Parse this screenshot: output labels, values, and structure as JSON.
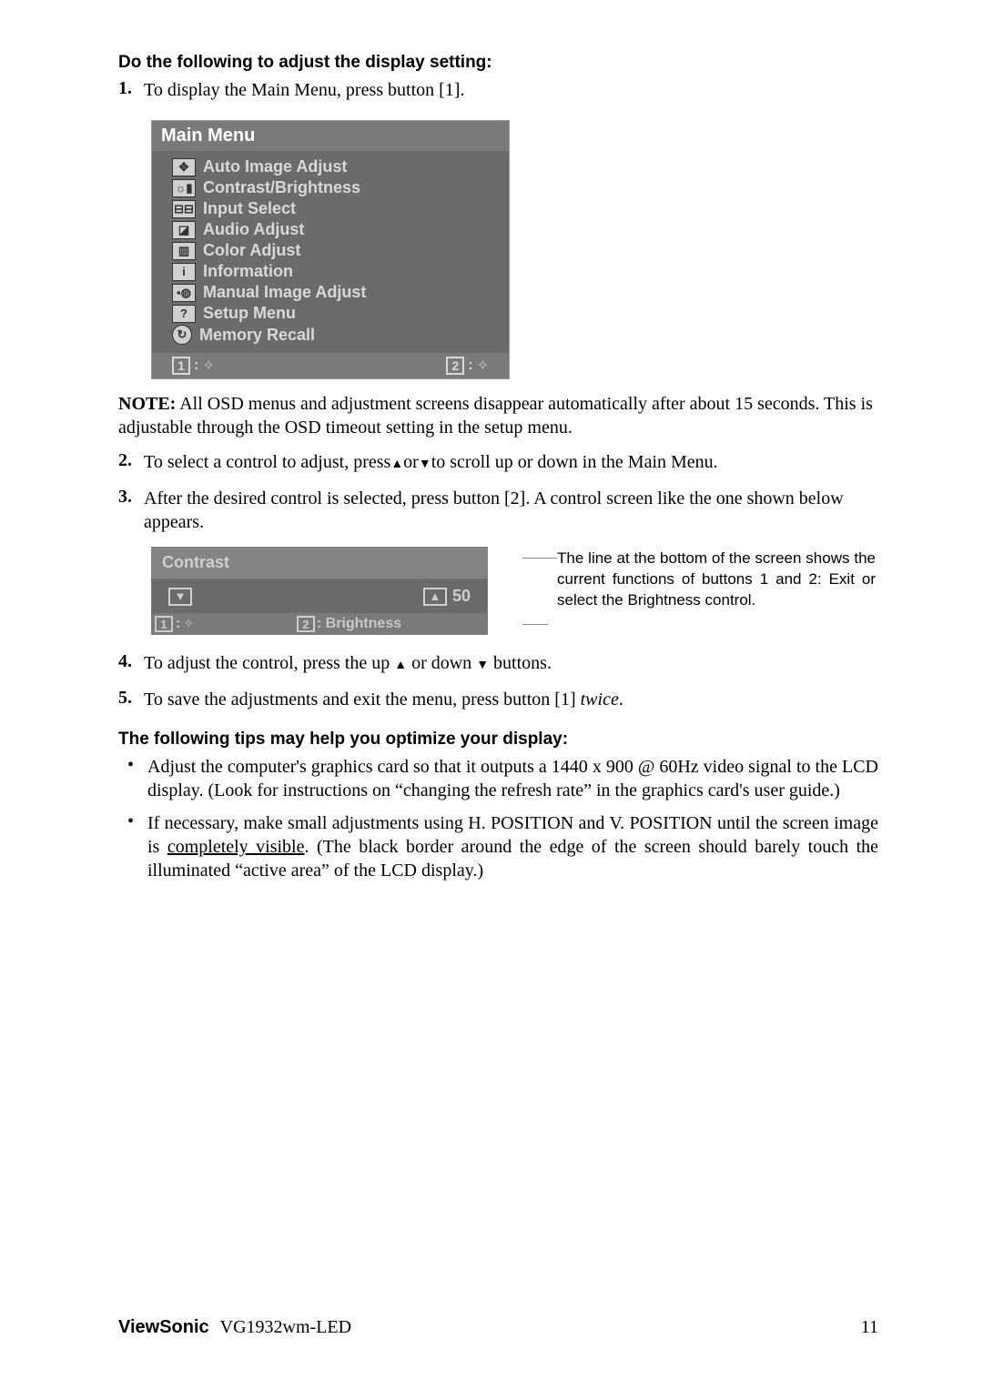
{
  "heading1": "Do the following to adjust the display setting:",
  "step1": {
    "num": "1.",
    "text": "To display the Main Menu, press button [1]."
  },
  "osd": {
    "title": "Main Menu",
    "items": [
      {
        "icon": "✥",
        "label": "Auto Image Adjust"
      },
      {
        "icon": "☼▮",
        "label": "Contrast/Brightness"
      },
      {
        "icon": "⊟⊟",
        "label": "Input Select"
      },
      {
        "icon": "◪",
        "label": "Audio Adjust"
      },
      {
        "icon": "▥",
        "label": "Color Adjust"
      },
      {
        "icon": "i",
        "label": "Information"
      },
      {
        "icon": "▪◍",
        "label": "Manual Image Adjust"
      },
      {
        "icon": "?",
        "label": "Setup Menu"
      },
      {
        "icon": "↻",
        "label": "Memory Recall",
        "round": true
      }
    ],
    "foot1": "1",
    "foot2": "2"
  },
  "note_label": "NOTE:",
  "note_text": " All OSD menus and adjustment screens disappear automatically after about 15 seconds. This is adjustable through the OSD timeout setting in the setup menu.",
  "step2": {
    "num": "2.",
    "pre": "To select a control to adjust, press",
    "post": "to scroll up or down in the Main Menu.",
    "or": "or"
  },
  "step3": {
    "num": "3.",
    "text": "After the desired control is selected, press button [2]. A control screen like the one shown below appears."
  },
  "contrast": {
    "title": "Contrast",
    "value": "50",
    "foot_left_num": "1",
    "foot_center_num": "2",
    "foot_center_label": ": Brightness"
  },
  "annotation": "The line at the bottom of the screen shows the current functions of buttons 1 and 2: Exit or select the Brightness control.",
  "step4": {
    "num": "4.",
    "pre": "To adjust the control, press the up ",
    "mid": " or down ",
    "post": " buttons."
  },
  "step5": {
    "num": "5.",
    "pre": "To save the adjustments and exit the menu, press button [1] ",
    "ital": "twice",
    "post": "."
  },
  "heading2": "The following tips may help you optimize your display:",
  "tip1": "Adjust the computer's graphics card so that it outputs a 1440 x 900 @ 60Hz video signal to the LCD display. (Look for instructions on “changing the refresh rate” in the graphics card's user guide.)",
  "tip2_pre": "If necessary, make small adjustments using H. POSITION and V. POSITION until the screen image is ",
  "tip2_underline": "completely visible",
  "tip2_post": ". (The black border around the edge of the screen should barely touch the illuminated “active area” of the LCD display.)",
  "footer": {
    "brand": "ViewSonic",
    "model": "VG1932wm-LED",
    "page": "11"
  }
}
